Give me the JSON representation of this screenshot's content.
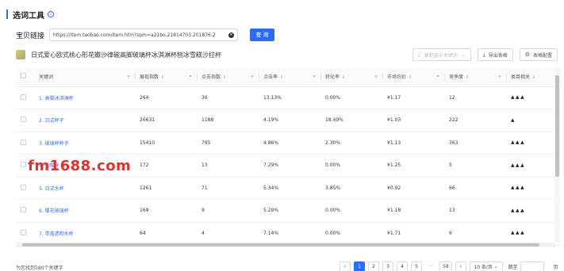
{
  "header": {
    "title": "选词工具"
  },
  "url_bar": {
    "label": "宝贝链接",
    "value": "https://item.taobao.com/item.htm?spm=a21bo.21814703.201876.2",
    "search_label": "查 询"
  },
  "product": {
    "title": "日式爱心欧式桃心形花瓣沙律碗高脚玻璃杯冰淇淋杯刨冰雪糕沙拉杯"
  },
  "toolbar": {
    "copy_label": "复制选中关键词",
    "export_label": "导出表格",
    "config_label": "表格配置"
  },
  "table": {
    "headers": [
      "关键词",
      "展现指数",
      "点击指数",
      "点击率",
      "转化率",
      "市场均价",
      "竞争度",
      "类目相关"
    ],
    "rows": [
      {
        "keyword": "1. 高脚冰淇淋杯",
        "impressions": "264",
        "clicks": "36",
        "ctr": "13.13%",
        "cvr": "0.00%",
        "price": "¥1.17",
        "competition": "12",
        "relevance": "3"
      },
      {
        "keyword": "2. 日式杯子",
        "impressions": "26631",
        "clicks": "1188",
        "ctr": "4.19%",
        "cvr": "18.49%",
        "price": "¥1.03",
        "competition": "222",
        "relevance": "1"
      },
      {
        "keyword": "3. 玻璃杯杯子",
        "impressions": "15410",
        "clicks": "795",
        "ctr": "4.86%",
        "cvr": "2.30%",
        "price": "¥1.13",
        "competition": "363",
        "relevance": "3"
      },
      {
        "keyword": "4. 雪糕杯",
        "impressions": "172",
        "clicks": "13",
        "ctr": "7.29%",
        "cvr": "0.00%",
        "price": "¥1.25",
        "competition": "5",
        "relevance": "3"
      },
      {
        "keyword": "5. 日式水杯",
        "impressions": "1261",
        "clicks": "71",
        "ctr": "5.34%",
        "cvr": "3.85%",
        "price": "¥0.92",
        "competition": "66",
        "relevance": "3"
      },
      {
        "keyword": "6. 樱花玻璃杯",
        "impressions": "169",
        "clicks": "9",
        "ctr": "5.29%",
        "cvr": "0.00%",
        "price": "¥1.18",
        "competition": "13",
        "relevance": "3"
      },
      {
        "keyword": "7. 带盖透明水杯",
        "impressions": "64",
        "clicks": "4",
        "ctr": "7.14%",
        "cvr": "0.00%",
        "price": "¥1.71",
        "competition": "6",
        "relevance": "3"
      }
    ]
  },
  "watermark": "fm1688.com",
  "footer": {
    "total_text": "为您找到580个关键字",
    "pages": [
      "1",
      "2",
      "3",
      "4",
      "5",
      "···",
      "58"
    ],
    "current_page": "1",
    "page_size": "10 条/页",
    "jump_label": "跳至",
    "page_suffix": "页"
  }
}
